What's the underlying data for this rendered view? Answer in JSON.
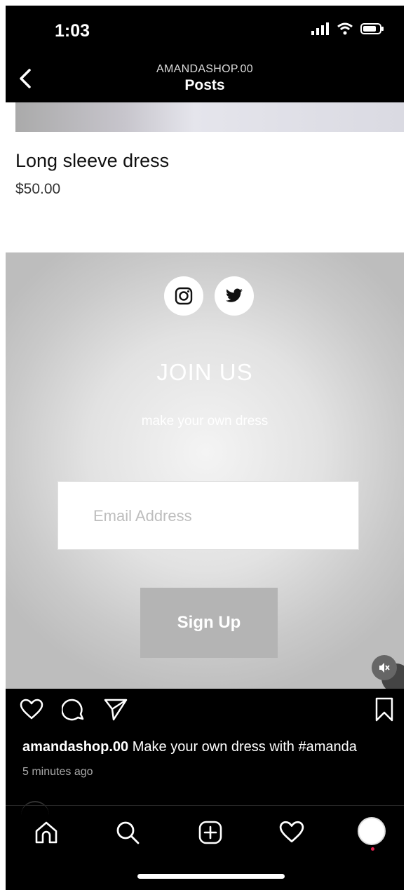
{
  "status_bar": {
    "time": "1:03"
  },
  "header": {
    "subtitle": "AMANDASHOP.00",
    "title": "Posts"
  },
  "product": {
    "name": "Long sleeve dress",
    "price": "$50.00"
  },
  "join": {
    "title": "JOIN US",
    "subtitle": "make your own dress",
    "email_placeholder": "Email Address",
    "signup_label": "Sign Up"
  },
  "caption": {
    "username": "amandashop.00",
    "text": " Make your own dress with #amanda",
    "time_ago": "5 minutes ago"
  },
  "icons": [
    "back-icon",
    "instagram-icon",
    "twitter-icon",
    "mute-icon",
    "heart-icon",
    "comment-icon",
    "share-icon",
    "bookmark-icon",
    "home-icon",
    "search-icon",
    "add-post-icon",
    "activity-icon"
  ]
}
